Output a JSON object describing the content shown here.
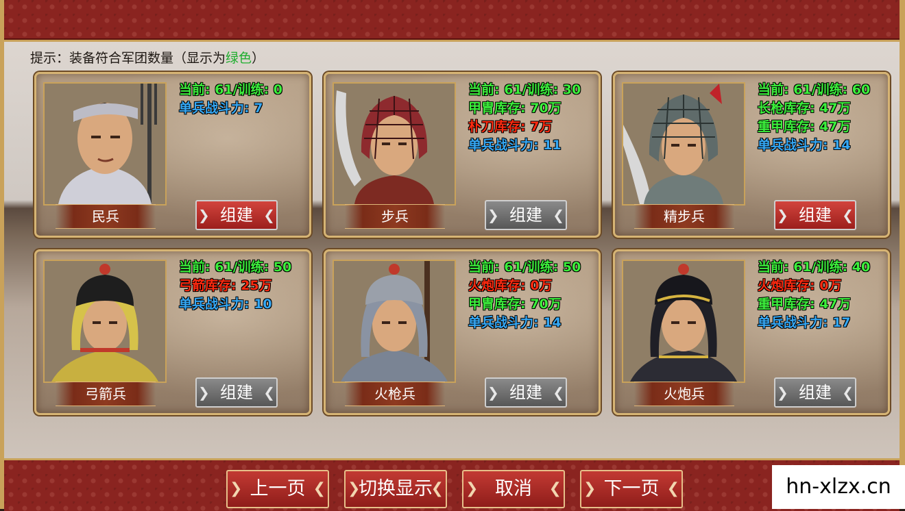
{
  "hint": {
    "prefix": "提示：装备符合军团数量（显示为",
    "highlight": "绿色",
    "suffix": "）"
  },
  "units": [
    {
      "name": "民兵",
      "stats": [
        {
          "text": "当前: 61/训练: 0",
          "color": "green"
        },
        {
          "text": "单兵战斗力: 7",
          "color": "blue"
        }
      ],
      "button": "组建",
      "button_state": "active"
    },
    {
      "name": "步兵",
      "stats": [
        {
          "text": "当前: 61/训练: 30",
          "color": "green"
        },
        {
          "text": "甲胄库存: 70万",
          "color": "green"
        },
        {
          "text": "朴刀库存: 7万",
          "color": "red"
        },
        {
          "text": "单兵战斗力: 11",
          "color": "blue"
        }
      ],
      "button": "组建",
      "button_state": "inactive"
    },
    {
      "name": "精步兵",
      "stats": [
        {
          "text": "当前: 61/训练: 60",
          "color": "green"
        },
        {
          "text": "长枪库存: 47万",
          "color": "green"
        },
        {
          "text": "重甲库存: 47万",
          "color": "green"
        },
        {
          "text": "单兵战斗力: 14",
          "color": "blue"
        }
      ],
      "button": "组建",
      "button_state": "active"
    },
    {
      "name": "弓箭兵",
      "stats": [
        {
          "text": "当前: 61/训练: 50",
          "color": "green"
        },
        {
          "text": "弓箭库存: 25万",
          "color": "red"
        },
        {
          "text": "单兵战斗力: 10",
          "color": "blue"
        }
      ],
      "button": "组建",
      "button_state": "inactive"
    },
    {
      "name": "火枪兵",
      "stats": [
        {
          "text": "当前: 61/训练: 50",
          "color": "green"
        },
        {
          "text": "火炮库存: 0万",
          "color": "red"
        },
        {
          "text": "甲胄库存: 70万",
          "color": "green"
        },
        {
          "text": "单兵战斗力: 14",
          "color": "blue"
        }
      ],
      "button": "组建",
      "button_state": "inactive"
    },
    {
      "name": "火炮兵",
      "stats": [
        {
          "text": "当前: 61/训练: 40",
          "color": "green"
        },
        {
          "text": "火炮库存: 0万",
          "color": "red"
        },
        {
          "text": "重甲库存: 47万",
          "color": "green"
        },
        {
          "text": "单兵战斗力: 17",
          "color": "blue"
        }
      ],
      "button": "组建",
      "button_state": "inactive"
    }
  ],
  "nav": {
    "prev": "上一页",
    "toggle": "切换显示",
    "cancel": "取消",
    "next": "下一页"
  },
  "watermark": "hn-xlzx.cn",
  "colors": {
    "green": "#3cf03c",
    "red": "#ff2a10",
    "blue": "#35a8f5",
    "button_active": "#b82d28",
    "button_inactive": "#6e6e6e",
    "banner": "#8a2420",
    "gold": "#c9a25a"
  }
}
